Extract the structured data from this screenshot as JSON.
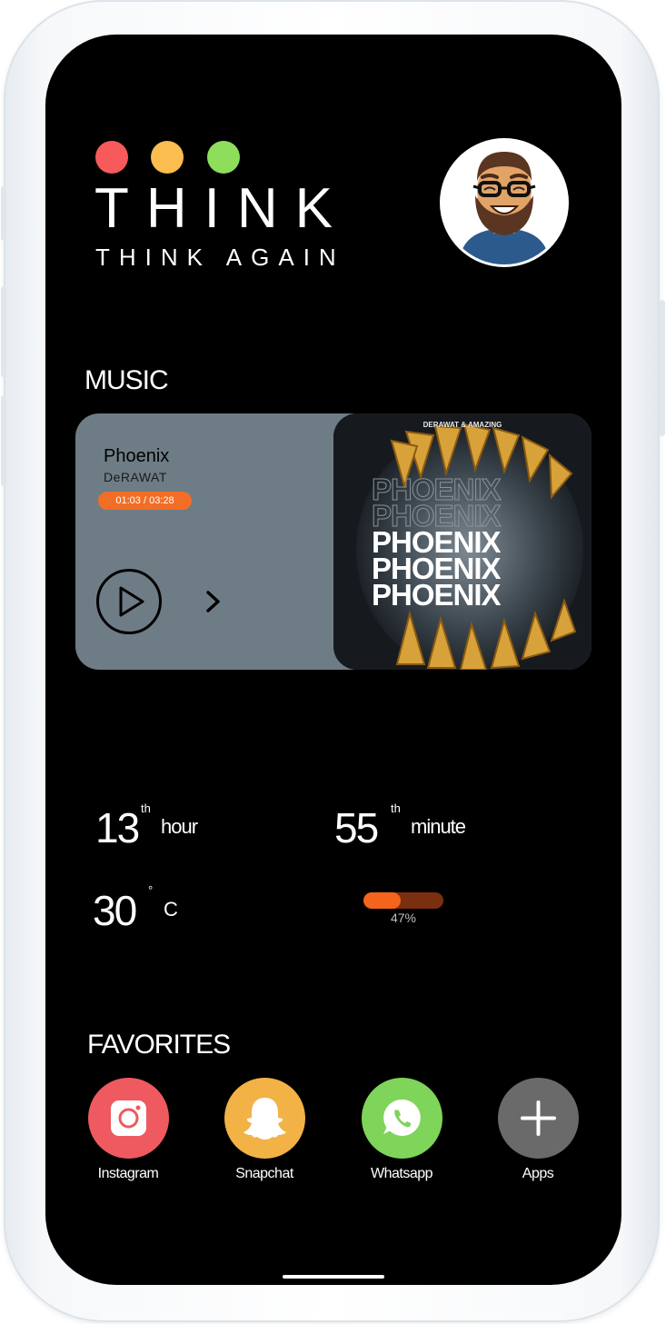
{
  "brand": {
    "title": "THINK",
    "subtitle": "THINK AGAIN"
  },
  "music": {
    "section_title": "MUSIC",
    "track_title": "Phoenix",
    "artist": "DeRAWAT",
    "time": "01:03 / 03:28",
    "album_credit": "DERAWAT & AMAZING",
    "album_word": "PHOENIX"
  },
  "stats": {
    "hour_value": "13",
    "hour_suffix": "th",
    "hour_unit": "hour",
    "minute_value": "55",
    "minute_suffix": "th",
    "minute_unit": "minute",
    "temp_value": "30",
    "temp_degree": "°",
    "temp_unit": "C",
    "battery_percent": 47,
    "battery_label": "47%"
  },
  "favorites": {
    "section_title": "FAVORITES",
    "items": [
      {
        "label": "Instagram",
        "color": "#ee5a5f",
        "icon": "instagram-icon"
      },
      {
        "label": "Snapchat",
        "color": "#f2b246",
        "icon": "snapchat-icon"
      },
      {
        "label": "Whatsapp",
        "color": "#7fd45a",
        "icon": "whatsapp-icon"
      },
      {
        "label": "Apps",
        "color": "#6a6a6a",
        "icon": "plus-icon"
      }
    ]
  },
  "colors": {
    "accent_orange": "#f26e26",
    "card_gray": "#6e7c85",
    "dot_red": "#f75a5a",
    "dot_yellow": "#fbbd4f",
    "dot_green": "#8ede5c"
  }
}
